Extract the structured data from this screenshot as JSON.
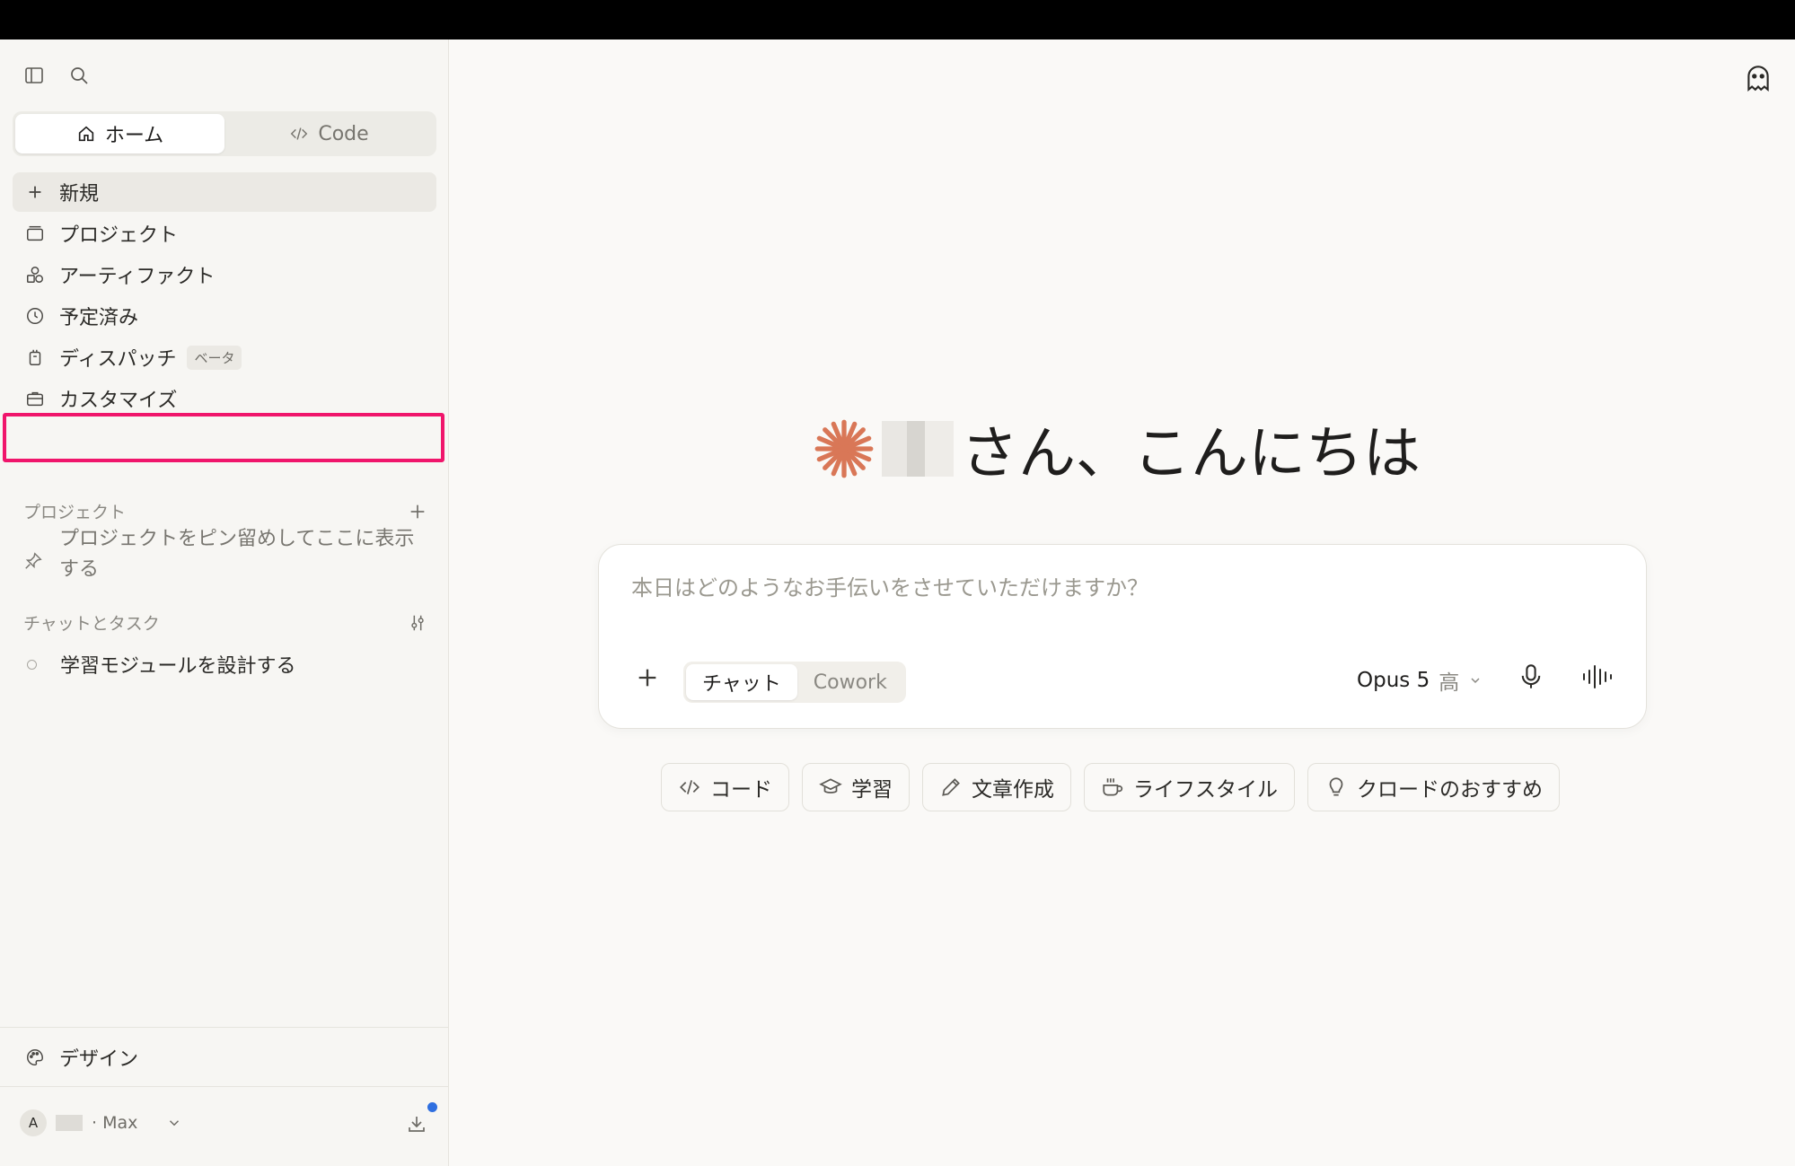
{
  "sidebar": {
    "mode_tabs": [
      {
        "label": "ホーム",
        "icon": "home-icon",
        "active": true
      },
      {
        "label": "Code",
        "icon": "code-icon",
        "active": false
      }
    ],
    "nav": {
      "new": "新規",
      "projects": "プロジェクト",
      "artifacts": "アーティファクト",
      "scheduled": "予定済み",
      "dispatch": "ディスパッチ",
      "dispatch_badge": "ベータ",
      "customize": "カスタマイズ"
    },
    "projects_section": {
      "title": "プロジェクト",
      "hint": "プロジェクトをピン留めしてここに表示する"
    },
    "chats_section": {
      "title": "チャットとタスク",
      "items": [
        "学習モジュールを設計する"
      ]
    },
    "design": "デザイン",
    "account": {
      "avatar_initial": "A",
      "plan": "· Max"
    }
  },
  "main": {
    "greeting": "さん、こんにちは",
    "composer": {
      "placeholder": "本日はどのようなお手伝いをさせていただけますか？",
      "modes": [
        "チャット",
        "Cowork"
      ],
      "model": "Opus 5",
      "effort": "高"
    },
    "chips": [
      "コード",
      "学習",
      "文章作成",
      "ライフスタイル",
      "クロードのおすすめ"
    ]
  },
  "colors": {
    "accent": "#d97757",
    "highlight": "#f0156b",
    "notification": "#2f6fe0"
  }
}
